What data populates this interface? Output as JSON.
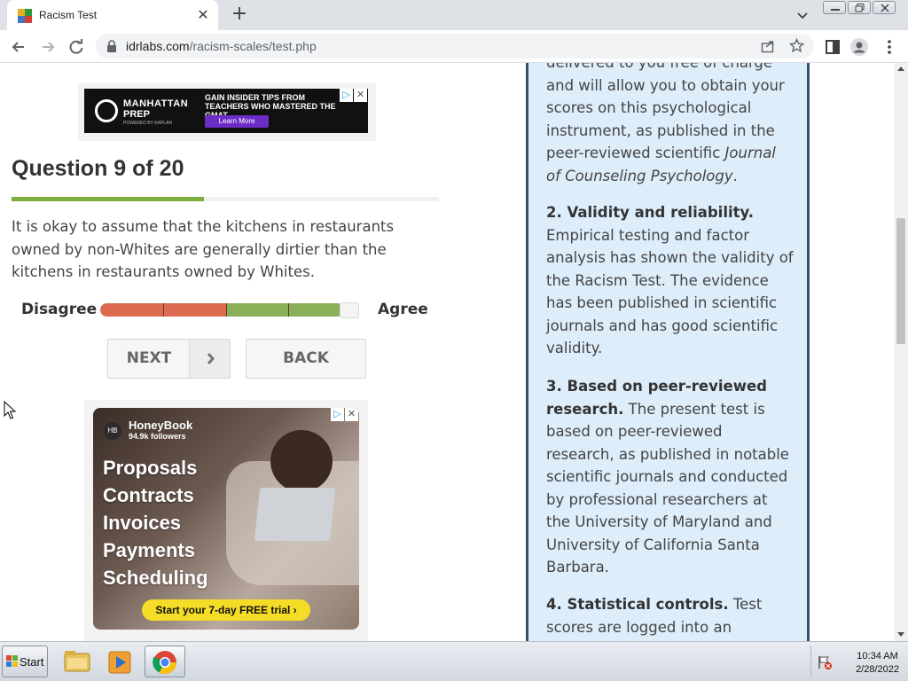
{
  "browser": {
    "tab_title": "Racism Test",
    "url_domain": "idrlabs.com",
    "url_path": "/racism-scales/test.php"
  },
  "ads": {
    "manhattan": {
      "brand_line1": "MANHATTAN",
      "brand_line2": "PREP",
      "brand_powered": "POWERED BY KAPLAN",
      "headline": "GAIN INSIDER TIPS FROM TEACHERS WHO MASTERED THE GMAT",
      "cta": "Learn More"
    },
    "honeybook": {
      "name": "HoneyBook",
      "followers": "94.9k followers",
      "logo_text": "HB",
      "words": [
        "Proposals",
        "Contracts",
        "Invoices",
        "Payments",
        "Scheduling"
      ],
      "cta": "Start your 7-day FREE trial ›"
    }
  },
  "question": {
    "title": "Question 9 of 20",
    "progress": 0.45,
    "text": "It is okay to assume that the kitchens in restaurants owned by non-Whites are generally dirtier than the kitchens in restaurants owned by Whites.",
    "scale_left": "Disagree",
    "scale_right": "Agree",
    "next_label": "NEXT",
    "back_label": "BACK"
  },
  "sidebar": {
    "p1_text": "delivered to you free of charge and will allow you to obtain your scores on this psychological instrument, as published in the peer-reviewed scientific ",
    "p1_journal": "Journal of Counseling Psychology",
    "p1_end": ".",
    "p2_head": "2. Validity and reliability.",
    "p2_text": " Empirical testing and factor analysis has shown the validity of the Racism Test. The evidence has been published in scientific journals and has good scientific validity.",
    "p3_head": "3. Based on peer-reviewed research.",
    "p3_text": " The present test is based on peer-reviewed research, as published in notable scientific journals and conducted by professional researchers at the University of Maryland and University of California Santa Barbara.",
    "p4_head": "4. Statistical controls.",
    "p4_text": " Test scores are logged into an anonymized"
  },
  "taskbar": {
    "start_label": "Start",
    "time": "10:34 AM",
    "date": "2/28/2022"
  },
  "colors": {
    "accent_green": "#7cad3e",
    "scale_red": "#dd6a50",
    "sidebar_bg": "#ddedfa",
    "sidebar_border": "#2f4f6b"
  }
}
